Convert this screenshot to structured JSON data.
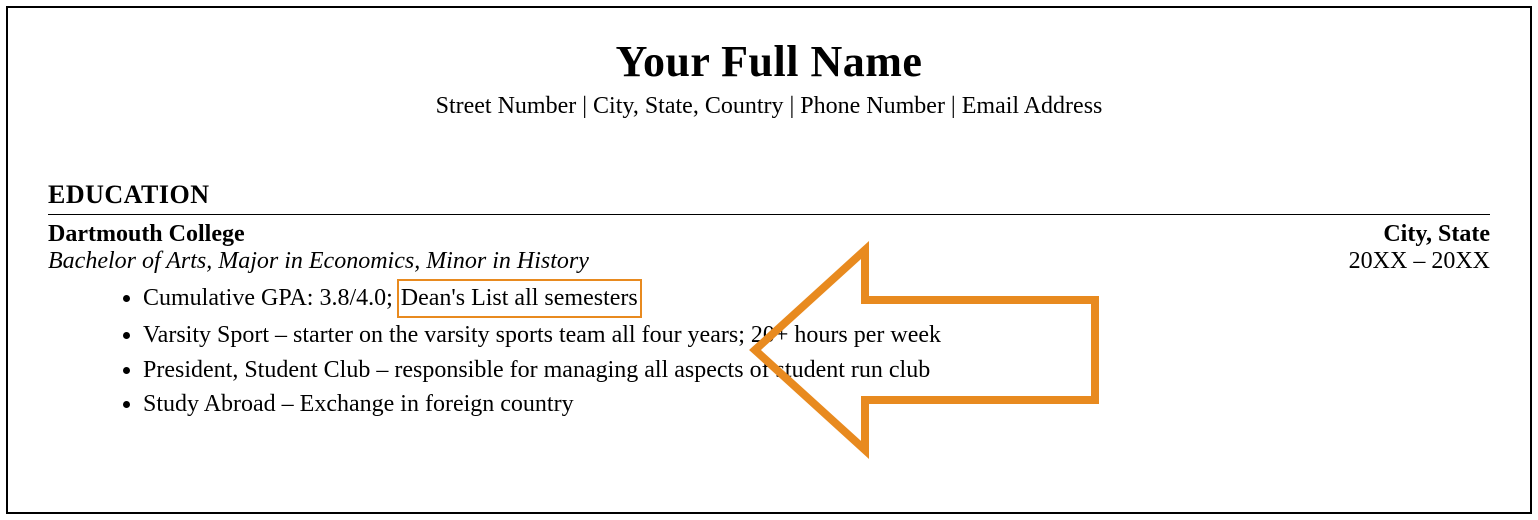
{
  "header": {
    "full_name": "Your Full Name",
    "contact_line": "Street Number | City, State, Country | Phone Number | Email Address"
  },
  "education": {
    "section_title": "EDUCATION",
    "school": "Dartmouth College",
    "location": "City, State",
    "degree": "Bachelor of Arts, Major in Economics, Minor in History",
    "dates": "20XX – 20XX",
    "bullets": {
      "b1_pre": "Cumulative GPA: 3.8/4.0; ",
      "b1_highlight": "Dean's List all semesters",
      "b2": "Varsity Sport – starter on the varsity sports team all four years; 20+ hours per week",
      "b3": "President, Student Club – responsible for managing all aspects of student run club",
      "b4": "Study Abroad – Exchange in foreign country"
    }
  },
  "annotation": {
    "arrow_color": "#e88a1f"
  }
}
